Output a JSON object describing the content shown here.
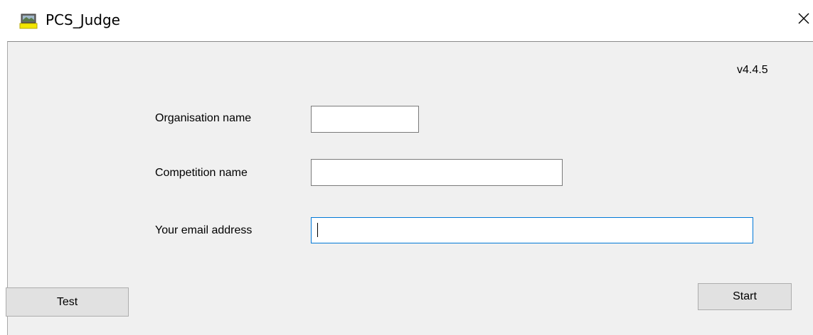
{
  "window": {
    "title": "PCS_Judge",
    "app_icon": "pcs-judge-app-icon",
    "close_icon": "close-icon"
  },
  "form": {
    "version": "v4.4.5",
    "organisation_label": "Organisation name",
    "organisation_value": "",
    "competition_label": "Competition name",
    "competition_value": "",
    "email_label": "Your email address",
    "email_value": ""
  },
  "buttons": {
    "test_label": "Test",
    "start_label": "Start"
  },
  "colors": {
    "client_background": "#f0f0f0",
    "focus_border": "#0078d7",
    "button_face": "#e1e1e1"
  }
}
